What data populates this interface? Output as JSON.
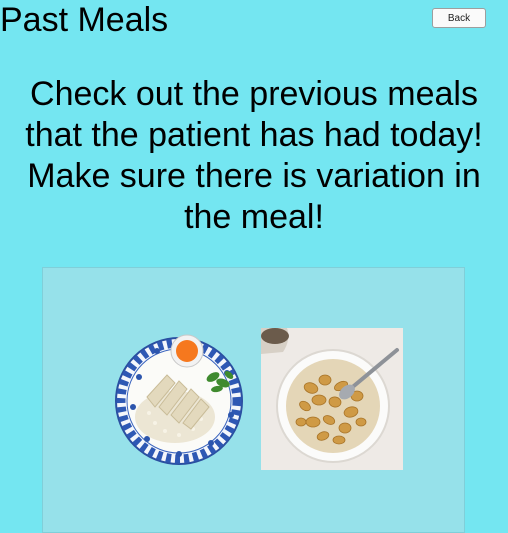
{
  "header": {
    "title": "Past Meals",
    "back_label": "Back"
  },
  "instructions": "Check out the previous meals that the patient has had today! Make sure there is variation in the meal!",
  "meals": [
    {
      "name": "chicken-rice-plate"
    },
    {
      "name": "cereal-bowl"
    }
  ]
}
